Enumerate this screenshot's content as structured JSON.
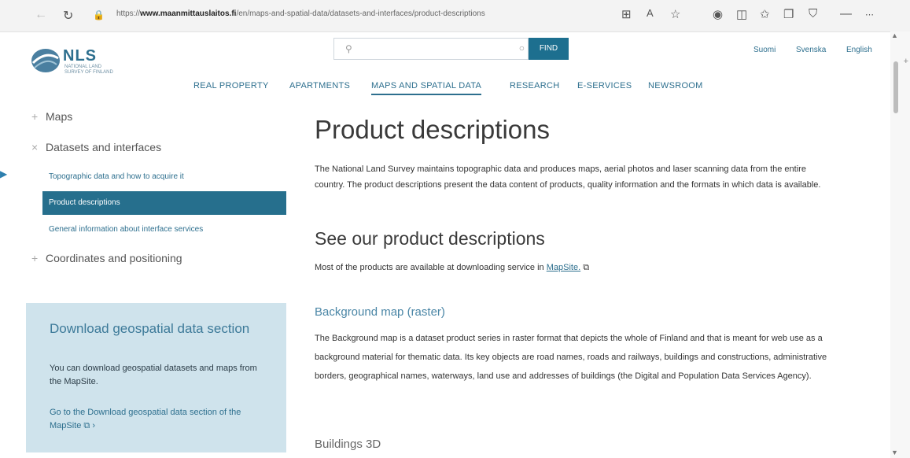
{
  "browser": {
    "url_prefix": "https://",
    "url_domain": "www.maanmittauslaitos.fi",
    "url_path": "/en/maps-and-spatial-data/datasets-and-interfaces/product-descriptions"
  },
  "header": {
    "logo_brand": "NLS",
    "logo_sub": "NATIONAL LAND SURVEY OF FINLAND",
    "search_placeholder": "",
    "find_label": "FIND",
    "languages": [
      "Suomi",
      "Svenska",
      "English"
    ],
    "nav": [
      "REAL PROPERTY",
      "APARTMENTS",
      "MAPS AND SPATIAL DATA",
      "RESEARCH",
      "E-SERVICES",
      "NEWSROOM"
    ],
    "active_nav": "MAPS AND SPATIAL DATA"
  },
  "sidebar": {
    "items": [
      {
        "label": "Maps",
        "icon": "plus-icon"
      },
      {
        "label": "Datasets and interfaces",
        "icon": "close-icon"
      }
    ],
    "subitems": [
      {
        "label": "Topographic data and how to acquire it"
      },
      {
        "label": "Product descriptions",
        "active": true
      },
      {
        "label": "General information about interface services"
      }
    ],
    "items_after": [
      {
        "label": "Coordinates and positioning",
        "icon": "plus-icon"
      }
    ]
  },
  "download_box": {
    "heading": "Download geospatial data section",
    "text": "You can download geospatial datasets and maps from the MapSite.",
    "link": "Go to the Download geospatial data section of the MapSite",
    "link_suffix": "›"
  },
  "main": {
    "title": "Product descriptions",
    "intro": "The National Land Survey maintains topographic data and produces maps, aerial photos and laser scanning data from the entire country. The product descriptions present the data content of products, quality information and the formats in which data is available.",
    "subtitle": "See our product descriptions",
    "sub_text_pre": "Most of the products are available at downloading service in ",
    "sub_text_link": "MapSite.",
    "products": [
      {
        "name": "Background map (raster)",
        "description": "The Background map is a dataset product series in raster format that depicts the whole of Finland and that is meant for web use as a background material for thematic data. Its key objects are road names, roads and railways, buildings and constructions, administrative borders, geographical names, waterways, land use and addresses of buildings (the Digital and Population Data Services Agency)."
      },
      {
        "name": "Buildings 3D"
      }
    ]
  },
  "colors": {
    "accent": "#266f8d",
    "box_bg": "#cfe3ec",
    "link": "#2d6f8e"
  }
}
